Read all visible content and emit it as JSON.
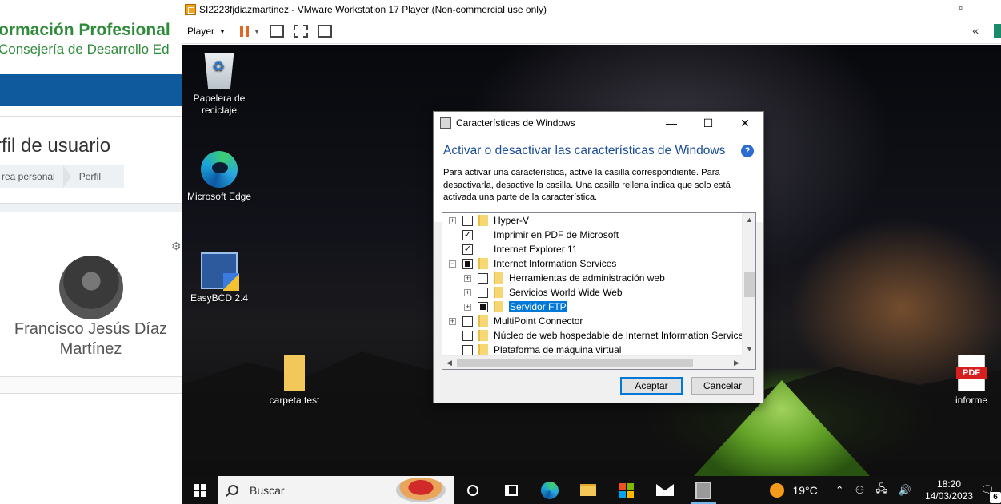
{
  "browser": {
    "site_title": "ormación Profesional",
    "site_subtitle": "Consejería de Desarrollo Ed",
    "page_title": "rfil de usuario",
    "breadcrumb": [
      "rea personal",
      "Perfil"
    ],
    "user_name": "Francisco Jesús Díaz Martínez"
  },
  "vmware": {
    "window_title": "SI2223fjdiazmartinez - VMware Workstation 17 Player (Non-commercial use only)",
    "minimize": "▫",
    "player_label": "Player",
    "collapse": "«"
  },
  "desktop": {
    "icons": [
      {
        "label": "Papelera de reciclaje",
        "icon": "recycle-bin-icon"
      },
      {
        "label": "Microsoft Edge",
        "icon": "edge-icon"
      },
      {
        "label": "EasyBCD 2.4",
        "icon": "easybcd-icon"
      },
      {
        "label": "carpeta test",
        "icon": "folder-icon"
      },
      {
        "label": "informe",
        "icon": "pdf-icon"
      }
    ]
  },
  "dialog": {
    "title": "Características de Windows",
    "heading": "Activar o desactivar las características de Windows",
    "help": "?",
    "description": "Para activar una característica, active la casilla correspondiente. Para desactivarla, desactive la casilla. Una casilla rellena indica que solo está activada una parte de la característica.",
    "features": [
      {
        "label": "Hyper-V",
        "level": 0,
        "expand": "+",
        "state": "unchecked",
        "folder": true
      },
      {
        "label": "Imprimir en PDF de Microsoft",
        "level": 0,
        "expand": "",
        "state": "checked",
        "folder": false
      },
      {
        "label": "Internet Explorer 11",
        "level": 0,
        "expand": "",
        "state": "checked",
        "folder": false
      },
      {
        "label": "Internet Information Services",
        "level": 0,
        "expand": "−",
        "state": "partial",
        "folder": true
      },
      {
        "label": "Herramientas de administración web",
        "level": 1,
        "expand": "+",
        "state": "unchecked",
        "folder": true
      },
      {
        "label": "Servicios World Wide Web",
        "level": 1,
        "expand": "+",
        "state": "unchecked",
        "folder": true
      },
      {
        "label": "Servidor FTP",
        "level": 1,
        "expand": "+",
        "state": "partial",
        "folder": true,
        "selected": true
      },
      {
        "label": "MultiPoint Connector",
        "level": 0,
        "expand": "+",
        "state": "unchecked",
        "folder": true
      },
      {
        "label": "Núcleo de web hospedable de Internet Information Services",
        "level": 0,
        "expand": "",
        "state": "unchecked",
        "folder": true
      },
      {
        "label": "Plataforma de máquina virtual",
        "level": 0,
        "expand": "",
        "state": "unchecked",
        "folder": true
      }
    ],
    "ok_label": "Aceptar",
    "cancel_label": "Cancelar"
  },
  "taskbar": {
    "search_placeholder": "Buscar",
    "weather": "19°C",
    "time": "18:20",
    "date": "14/03/2023",
    "notification_count": "6"
  }
}
